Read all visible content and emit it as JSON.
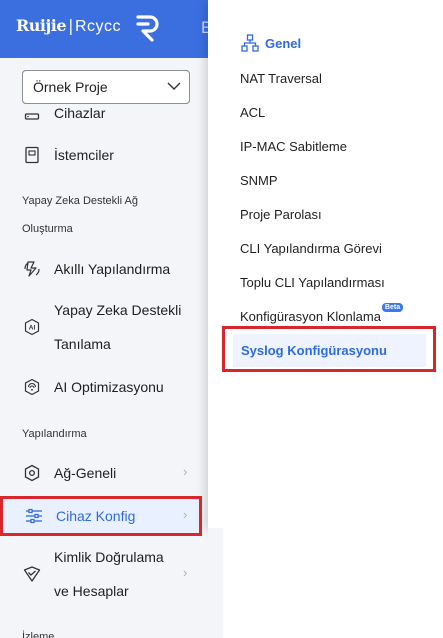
{
  "header": {
    "brand": "Ruijie",
    "brand_separator": "|",
    "brand_sub": "Rcycc",
    "edge_text": "E"
  },
  "project_select": {
    "value": "Örnek Proje"
  },
  "sidebar": {
    "items": [
      {
        "label": "Cihazlar",
        "icon": "device-icon"
      },
      {
        "label": "İstemciler",
        "icon": "client-icon"
      },
      {
        "label": "Akıllı Yapılandırma",
        "icon": "smart-config-icon"
      },
      {
        "label_line1": "Yapay Zeka Destekli",
        "label_line2": "Tanılama",
        "icon": "ai-diagnosis-icon"
      },
      {
        "label": "AI Optimizasyonu",
        "icon": "ai-optimization-icon"
      },
      {
        "label": "Ağ-Geneli",
        "icon": "network-wide-icon"
      },
      {
        "label": "Cihaz Konfig",
        "icon": "device-config-icon"
      },
      {
        "label_line1": "Kimlik Doğrulama",
        "label_line2": "ve Hesaplar",
        "icon": "auth-accounts-icon"
      }
    ],
    "sections": {
      "ai_line1": "Yapay Zeka Destekli Ağ",
      "ai_line2": "Oluşturma",
      "config": "Yapılandırma",
      "monitor": "İzleme"
    }
  },
  "flyout": {
    "header": "Genel",
    "items": [
      "NAT Traversal",
      "ACL",
      "IP-MAC Sabitleme",
      "SNMP",
      "Proje Parolası",
      "CLI Yapılandırma Görevi",
      "Toplu CLI Yapılandırması",
      "Konfigürasyon Klonlama"
    ],
    "beta_badge": "Beta",
    "active_item": "Syslog Konfigürasyonu"
  },
  "colors": {
    "accent": "#2f6ae0",
    "header_bg": "#3b6fe0",
    "highlight": "#d9262c"
  }
}
